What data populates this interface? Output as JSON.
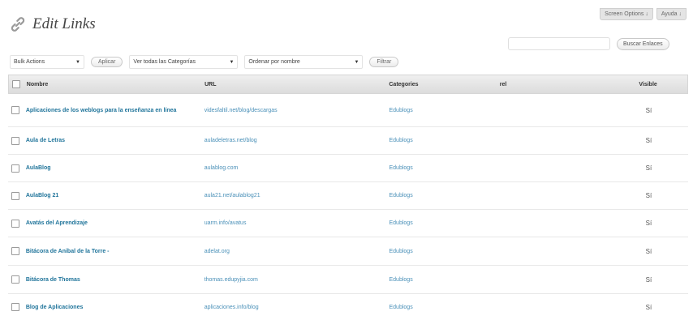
{
  "screen_meta": {
    "options_label": "Screen Options ↓",
    "help_label": "Ayuda ↓"
  },
  "header": {
    "title": "Edit Links",
    "icon": "links-chain-icon"
  },
  "search": {
    "placeholder": "",
    "button_label": "Buscar Enlaces"
  },
  "filters": {
    "bulk_actions": "Bulk Actions",
    "apply_label": "Aplicar",
    "categories": "Ver todas las Categorías",
    "order": "Ordenar por nombre",
    "filter_label": "Filtrar"
  },
  "table": {
    "columns": {
      "name": "Nombre",
      "url": "URL",
      "categories": "Categories",
      "rel": "rel",
      "visible": "Visible"
    },
    "rows": [
      {
        "name": "Aplicaciones de los weblogs para la enseñanza en línea",
        "url": "videsfaltil.net/blog/descargas",
        "category": "Edublogs",
        "rel": "",
        "visible": "Sí"
      },
      {
        "name": "Aula de Letras",
        "url": "auladeletras.net/blog",
        "category": "Edublogs",
        "rel": "",
        "visible": "Sí"
      },
      {
        "name": "AulaBlog",
        "url": "aulablog.com",
        "category": "Edublogs",
        "rel": "",
        "visible": "Sí"
      },
      {
        "name": "AulaBlog 21",
        "url": "aula21.net/aulablog21",
        "category": "Edublogs",
        "rel": "",
        "visible": "Sí"
      },
      {
        "name": "Avatás del Aprendizaje",
        "url": "uarm.info/avatus",
        "category": "Edublogs",
        "rel": "",
        "visible": "Sí"
      },
      {
        "name": "Bitácora de Anibal de la Torre -",
        "url": "adelat.org",
        "category": "Edublogs",
        "rel": "",
        "visible": "Sí"
      },
      {
        "name": "Bitácora de Thomas",
        "url": "thomas.edupyjia.com",
        "category": "Edublogs",
        "rel": "",
        "visible": "Sí"
      },
      {
        "name": "Blog de Aplicaciones",
        "url": "aplicaciones.info/blog",
        "category": "Edublogs",
        "rel": "",
        "visible": "Sí"
      }
    ]
  },
  "colors": {
    "link": "#21759b",
    "header_bg": "#dcdcdc"
  }
}
